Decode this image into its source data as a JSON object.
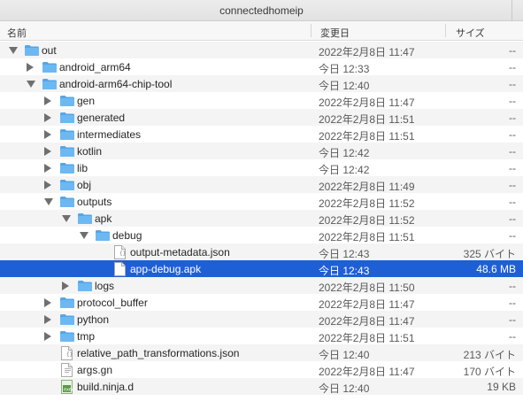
{
  "window": {
    "title": "connectedhomeip"
  },
  "columns": {
    "name": "名前",
    "date": "変更日",
    "size": "サイズ"
  },
  "colors": {
    "selection": "#1f5fd6",
    "folder": "#6cb8f3",
    "folder_dark": "#55a6e6"
  },
  "rows": [
    {
      "name": "out",
      "date": "2022年2月8日 11:47",
      "size": "--",
      "type": "folder",
      "depth": 0,
      "disclosure": "expanded",
      "icon": "folder-icon"
    },
    {
      "name": "android_arm64",
      "date": "今日 12:33",
      "size": "--",
      "type": "folder",
      "depth": 1,
      "disclosure": "collapsed",
      "icon": "folder-icon"
    },
    {
      "name": "android-arm64-chip-tool",
      "date": "今日 12:40",
      "size": "--",
      "type": "folder",
      "depth": 1,
      "disclosure": "expanded",
      "icon": "folder-icon"
    },
    {
      "name": "gen",
      "date": "2022年2月8日 11:47",
      "size": "--",
      "type": "folder",
      "depth": 2,
      "disclosure": "collapsed",
      "icon": "folder-icon"
    },
    {
      "name": "generated",
      "date": "2022年2月8日 11:51",
      "size": "--",
      "type": "folder",
      "depth": 2,
      "disclosure": "collapsed",
      "icon": "folder-icon"
    },
    {
      "name": "intermediates",
      "date": "2022年2月8日 11:51",
      "size": "--",
      "type": "folder",
      "depth": 2,
      "disclosure": "collapsed",
      "icon": "folder-icon"
    },
    {
      "name": "kotlin",
      "date": "今日 12:42",
      "size": "--",
      "type": "folder",
      "depth": 2,
      "disclosure": "collapsed",
      "icon": "folder-icon"
    },
    {
      "name": "lib",
      "date": "今日 12:42",
      "size": "--",
      "type": "folder",
      "depth": 2,
      "disclosure": "collapsed",
      "icon": "folder-icon"
    },
    {
      "name": "obj",
      "date": "2022年2月8日 11:49",
      "size": "--",
      "type": "folder",
      "depth": 2,
      "disclosure": "collapsed",
      "icon": "folder-icon"
    },
    {
      "name": "outputs",
      "date": "2022年2月8日 11:52",
      "size": "--",
      "type": "folder",
      "depth": 2,
      "disclosure": "expanded",
      "icon": "folder-icon"
    },
    {
      "name": "apk",
      "date": "2022年2月8日 11:52",
      "size": "--",
      "type": "folder",
      "depth": 3,
      "disclosure": "expanded",
      "icon": "folder-icon"
    },
    {
      "name": "debug",
      "date": "2022年2月8日 11:51",
      "size": "--",
      "type": "folder",
      "depth": 4,
      "disclosure": "expanded",
      "icon": "folder-icon"
    },
    {
      "name": "output-metadata.json",
      "date": "今日 12:43",
      "size": "325 バイト",
      "type": "json",
      "depth": 5,
      "disclosure": "none",
      "icon": "json-file-icon"
    },
    {
      "name": "app-debug.apk",
      "date": "今日 12:43",
      "size": "48.6 MB",
      "type": "file",
      "depth": 5,
      "disclosure": "none",
      "icon": "file-icon",
      "selected": true
    },
    {
      "name": "logs",
      "date": "2022年2月8日 11:50",
      "size": "--",
      "type": "folder",
      "depth": 3,
      "disclosure": "collapsed",
      "icon": "folder-icon"
    },
    {
      "name": "protocol_buffer",
      "date": "2022年2月8日 11:47",
      "size": "--",
      "type": "folder",
      "depth": 2,
      "disclosure": "collapsed",
      "icon": "folder-icon"
    },
    {
      "name": "python",
      "date": "2022年2月8日 11:47",
      "size": "--",
      "type": "folder",
      "depth": 2,
      "disclosure": "collapsed",
      "icon": "folder-icon"
    },
    {
      "name": "tmp",
      "date": "2022年2月8日 11:51",
      "size": "--",
      "type": "folder",
      "depth": 2,
      "disclosure": "collapsed",
      "icon": "folder-icon"
    },
    {
      "name": "relative_path_transformations.json",
      "date": "今日 12:40",
      "size": "213 バイト",
      "type": "json",
      "depth": 2,
      "disclosure": "none",
      "icon": "json-file-icon"
    },
    {
      "name": "args.gn",
      "date": "2022年2月8日 11:47",
      "size": "170 バイト",
      "type": "text",
      "depth": 2,
      "disclosure": "none",
      "icon": "text-file-icon"
    },
    {
      "name": "build.ninja.d",
      "date": "今日 12:40",
      "size": "19 KB",
      "type": "script",
      "depth": 2,
      "disclosure": "none",
      "icon": "script-file-icon"
    }
  ]
}
